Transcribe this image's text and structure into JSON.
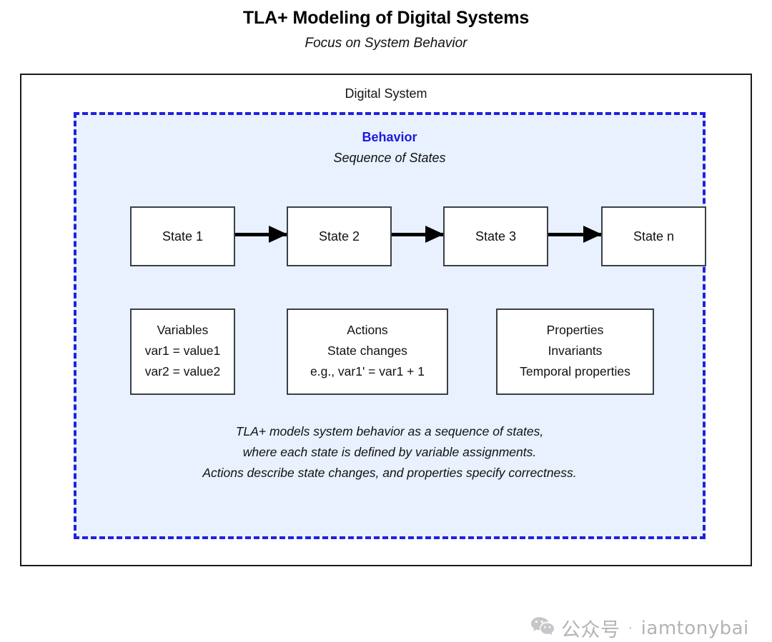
{
  "header": {
    "title": "TLA+ Modeling of Digital Systems",
    "subtitle": "Focus on System Behavior"
  },
  "system": {
    "label": "Digital System"
  },
  "behavior": {
    "title": "Behavior",
    "subtitle": "Sequence of States",
    "accent_color": "#1b1bdd",
    "background_color": "#e8f1fd",
    "note_lines": [
      "TLA+ models system behavior as a sequence of states,",
      "where each state is defined by variable assignments.",
      "Actions describe state changes, and properties specify correctness."
    ],
    "states": [
      {
        "label": "State 1"
      },
      {
        "label": "State 2"
      },
      {
        "label": "State 3"
      },
      {
        "label": "State n"
      }
    ],
    "concepts": [
      {
        "title": "Variables",
        "lines": [
          "Variables",
          "var1 = value1",
          "var2 = value2",
          "..."
        ]
      },
      {
        "title": "Actions",
        "lines": [
          "Actions",
          "State changes",
          "e.g., var1' = var1 + 1"
        ]
      },
      {
        "title": "Properties",
        "lines": [
          "Properties",
          "Invariants",
          "Temporal properties"
        ]
      }
    ]
  },
  "watermark": {
    "icon": "wechat-icon",
    "cn_label": "公众号",
    "separator": "·",
    "account": "iamtonybai"
  }
}
